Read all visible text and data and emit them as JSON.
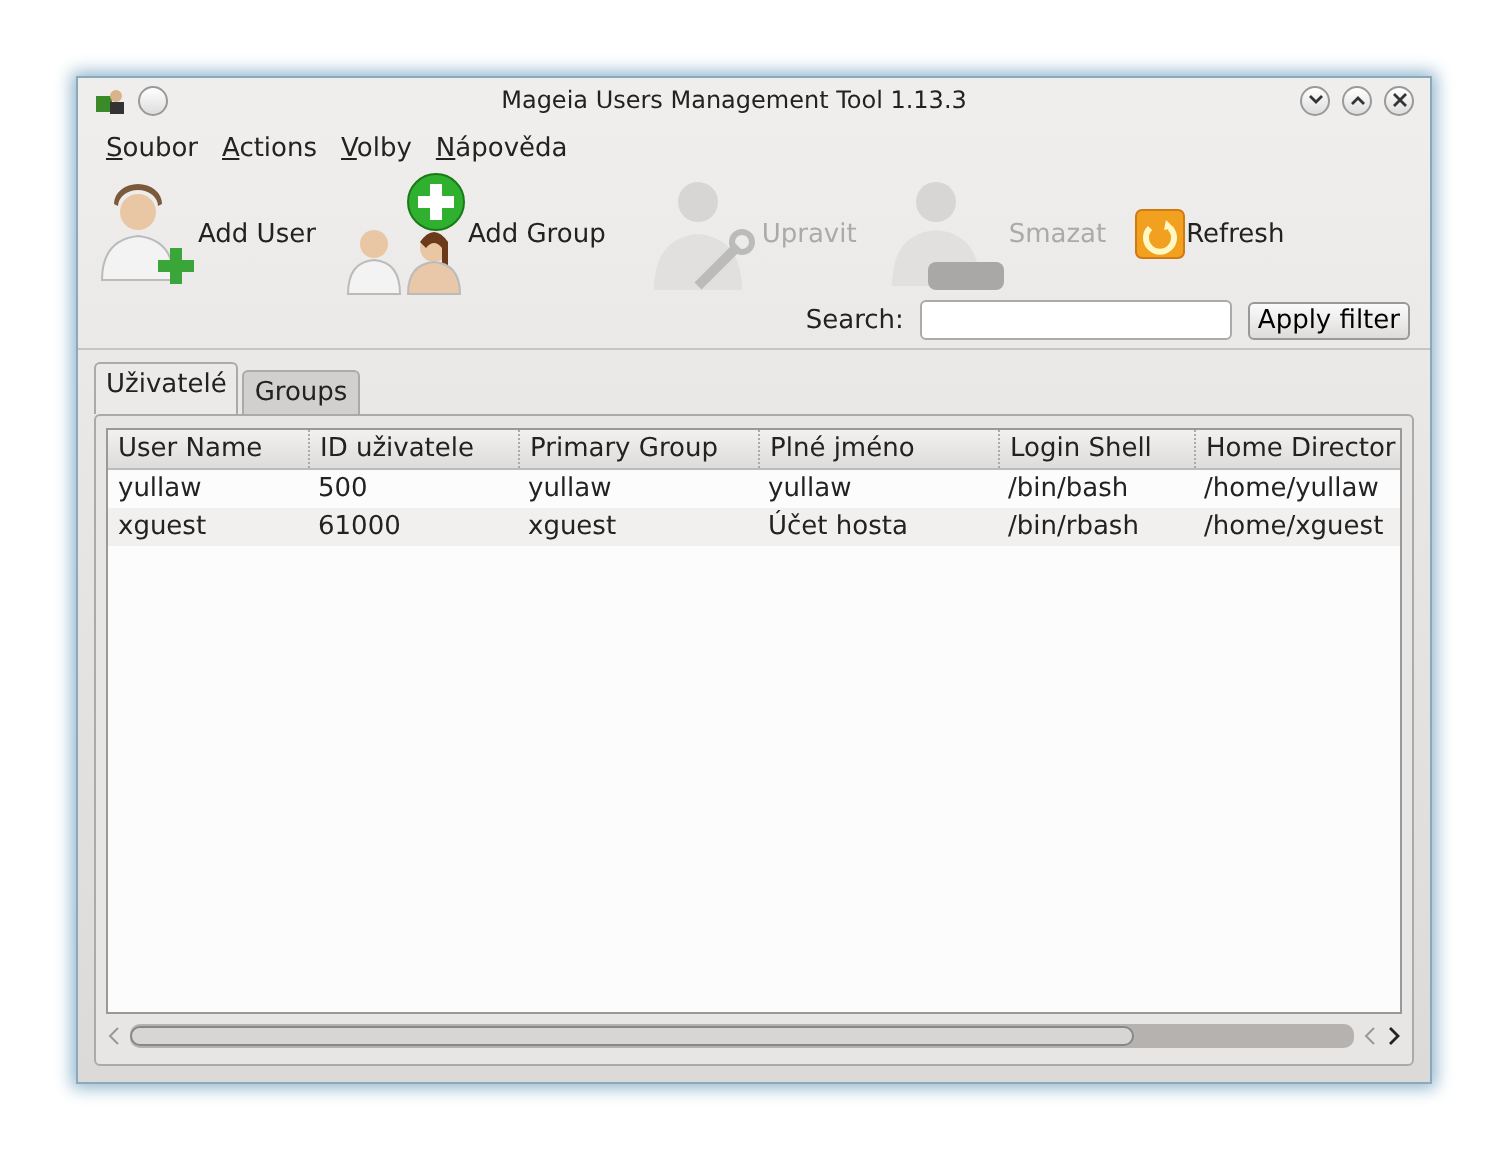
{
  "window": {
    "title": "Mageia Users Management Tool 1.13.3"
  },
  "menu": [
    "Soubor",
    "Actions",
    "Volby",
    "Nápověda"
  ],
  "toolbar": [
    {
      "kind": "add-user",
      "label": "Add User",
      "disabled": false
    },
    {
      "kind": "add-group",
      "label": "Add Group",
      "disabled": false
    },
    {
      "kind": "edit",
      "label": "Upravit",
      "disabled": true
    },
    {
      "kind": "delete",
      "label": "Smazat",
      "disabled": true
    },
    {
      "kind": "refresh",
      "label": "Refresh",
      "disabled": false
    }
  ],
  "search": {
    "label": "Search:",
    "button": "Apply filter"
  },
  "tabs": [
    {
      "label": "Uživatelé",
      "selected": true
    },
    {
      "label": "Groups",
      "selected": false
    }
  ],
  "table": {
    "columns": [
      "User Name",
      "ID uživatele",
      "Primary Group",
      "Plné jméno",
      "Login Shell",
      "Home Director"
    ],
    "rows": [
      [
        "yullaw",
        "500",
        "yullaw",
        "yullaw",
        "/bin/bash",
        "/home/yullaw"
      ],
      [
        "xguest",
        "61000",
        "xguest",
        "Účet hosta",
        "/bin/rbash",
        "/home/xguest"
      ]
    ]
  }
}
